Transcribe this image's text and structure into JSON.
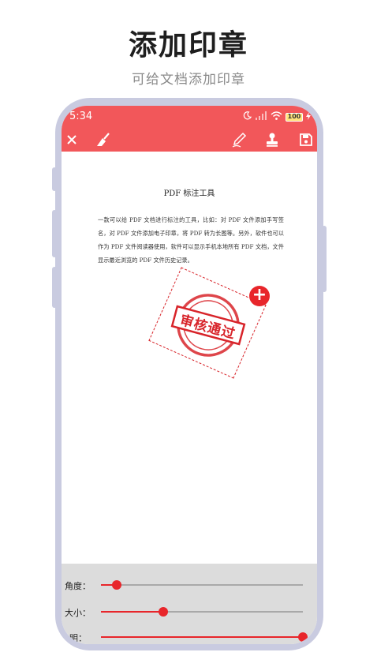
{
  "hero": {
    "title": "添加印章",
    "subtitle": "可给文档添加印章"
  },
  "status_bar": {
    "time": "5:34",
    "battery": "100"
  },
  "toolbar": {
    "close_icon": "close-icon",
    "clean_icon": "broom-icon",
    "sign_icon": "pen-icon",
    "stamp_icon": "stamp-icon",
    "save_icon": "save-icon",
    "bar_color": "#f2575a"
  },
  "document": {
    "title": "PDF 标注工具",
    "body": "一款可以给 PDF 文档进行标注的工具，比如：对 PDF 文件添加手写签名，对 PDF 文件添加电子印章，将 PDF 转为长图等。另外，软件也可以作为 PDF 文件阅读器使用，软件可以显示手机本地所有 PDF 文档，文件显示最近浏览的 PDF 文件历史记录。"
  },
  "stamp": {
    "text": "审核通过",
    "color": "#d8242a",
    "add_label": "+"
  },
  "controls": {
    "angle_label": "角度：",
    "angle_value": 0.08,
    "size_label": "大小：",
    "size_value": 0.31,
    "third_label": "明：",
    "third_value": 1.0
  }
}
